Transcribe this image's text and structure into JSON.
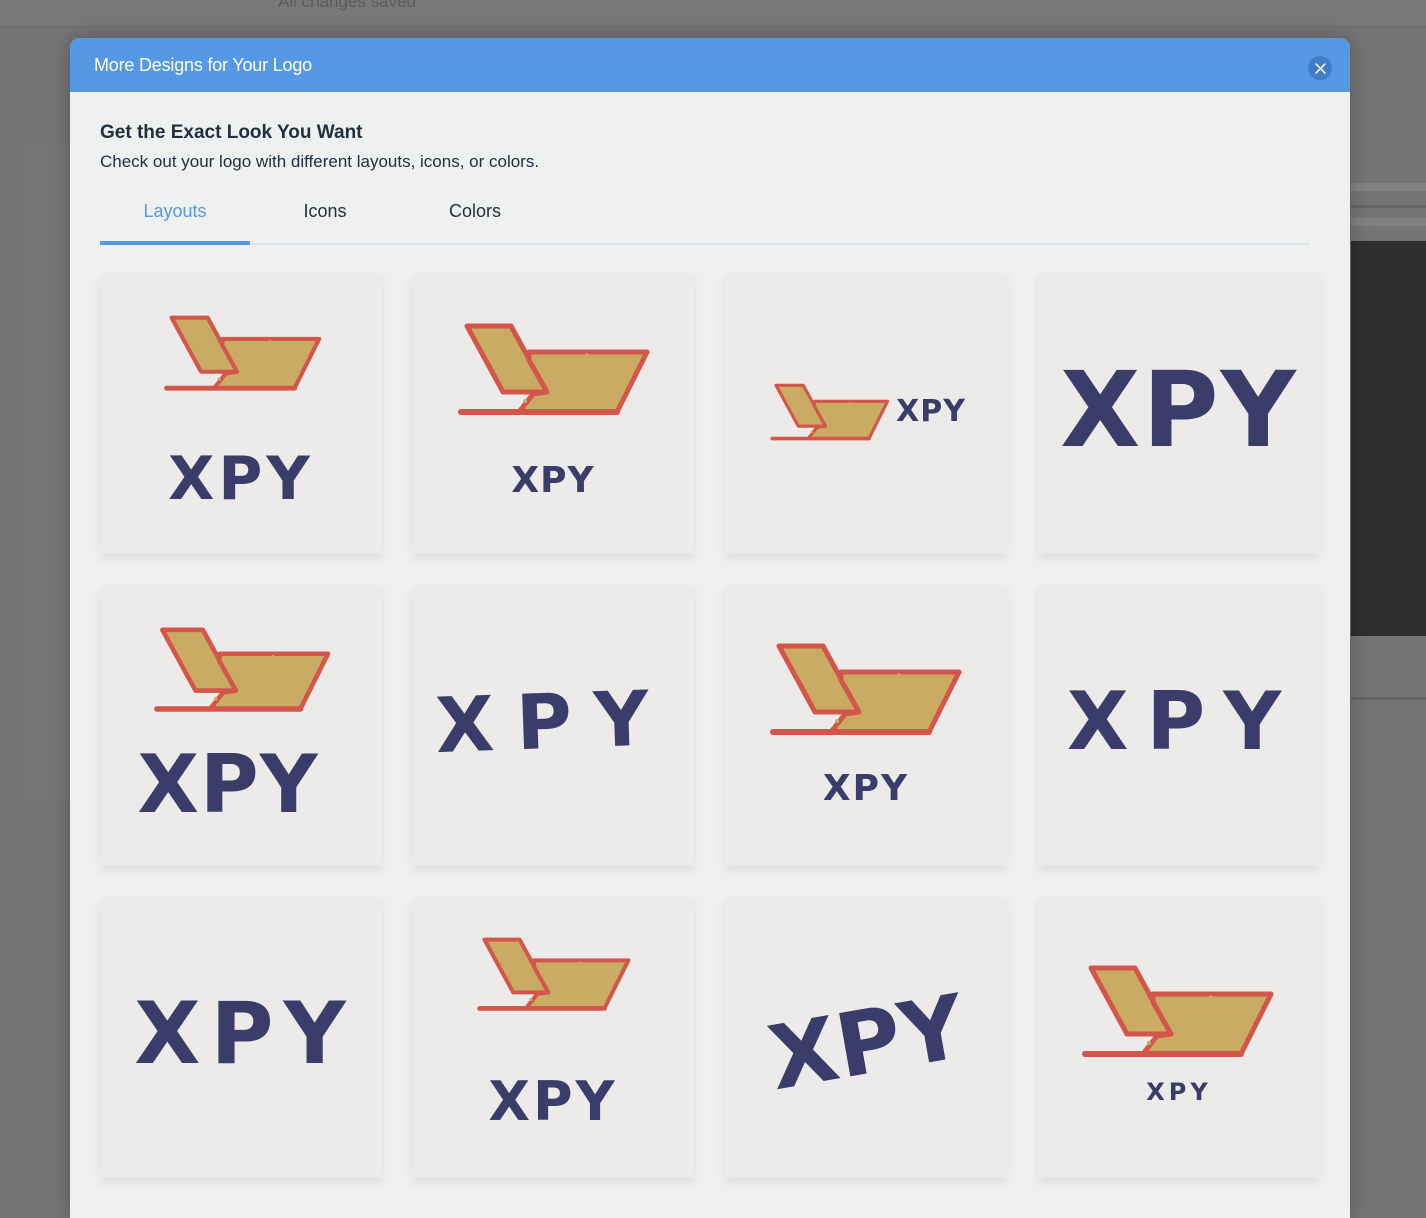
{
  "background": {
    "status_text": "All changes saved"
  },
  "modal": {
    "title": "More Designs for Your Logo",
    "close_icon": "close-icon",
    "intro_title": "Get the Exact Look You Want",
    "intro_subtitle": "Check out your logo with different layouts, icons, or colors.",
    "tabs": [
      {
        "label": "Layouts",
        "active": true
      },
      {
        "label": "Icons",
        "active": false
      },
      {
        "label": "Colors",
        "active": false
      }
    ]
  },
  "logo": {
    "text": "XPY",
    "icon": "laptop-tablet-icon",
    "colors": {
      "text": "#3b3c69",
      "icon_outline": "#d4554a",
      "icon_fill": "#c9ab64",
      "accent": "#5598e3"
    }
  },
  "layouts": [
    {
      "name": "icon-above-text"
    },
    {
      "name": "large-icon-above-small-text"
    },
    {
      "name": "icon-left-of-text"
    },
    {
      "name": "text-only-large"
    },
    {
      "name": "icon-above-text-left-aligned"
    },
    {
      "name": "text-only-spaced-tilted"
    },
    {
      "name": "icon-above-small-text"
    },
    {
      "name": "text-only-spaced"
    },
    {
      "name": "text-only-wide"
    },
    {
      "name": "icon-above-text-medium"
    },
    {
      "name": "text-only-rotated"
    },
    {
      "name": "large-icon-above-tiny-text"
    }
  ]
}
